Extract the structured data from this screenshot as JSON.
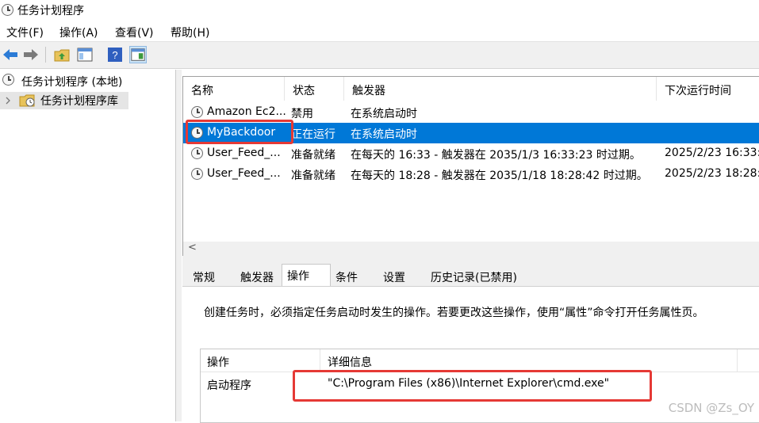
{
  "window": {
    "title": "任务计划程序"
  },
  "menu": {
    "file": "文件(F)",
    "action": "操作(A)",
    "view": "查看(V)",
    "help": "帮助(H)"
  },
  "tree": {
    "root": "任务计划程序 (本地)",
    "library": "任务计划程序库"
  },
  "task_list": {
    "headers": {
      "name": "名称",
      "status": "状态",
      "trigger": "触发器",
      "next_run": "下次运行时间"
    },
    "rows": [
      {
        "name": "Amazon Ec2...",
        "status": "禁用",
        "trigger": "在系统启动时",
        "next_run": ""
      },
      {
        "name": "MyBackdoor",
        "status": "正在运行",
        "trigger": "在系统启动时",
        "next_run": ""
      },
      {
        "name": "User_Feed_...",
        "status": "准备就绪",
        "trigger": "在每天的 16:33 - 触发器在 2035/1/3 16:33:23 时过期。",
        "next_run": "2025/2/23 16:33:"
      },
      {
        "name": "User_Feed_...",
        "status": "准备就绪",
        "trigger": "在每天的 18:28 - 触发器在 2035/1/18 18:28:42 时过期。",
        "next_run": "2025/2/23 18:28:"
      }
    ],
    "scroll_left_glyph": "<"
  },
  "tabs": [
    "常规",
    "触发器",
    "操作",
    "条件",
    "设置",
    "历史记录(已禁用)"
  ],
  "actions_tab": {
    "description": "创建任务时，必须指定任务启动时发生的操作。若要更改这些操作，使用“属性”命令打开任务属性页。",
    "headers": {
      "action": "操作",
      "details": "详细信息"
    },
    "rows": [
      {
        "action": "启动程序",
        "details": "\"C:\\Program Files (x86)\\Internet Explorer\\cmd.exe\""
      }
    ]
  },
  "watermark": "CSDN @Zs_OY",
  "colors": {
    "selection": "#0078d7",
    "highlight_box": "#e53935"
  }
}
